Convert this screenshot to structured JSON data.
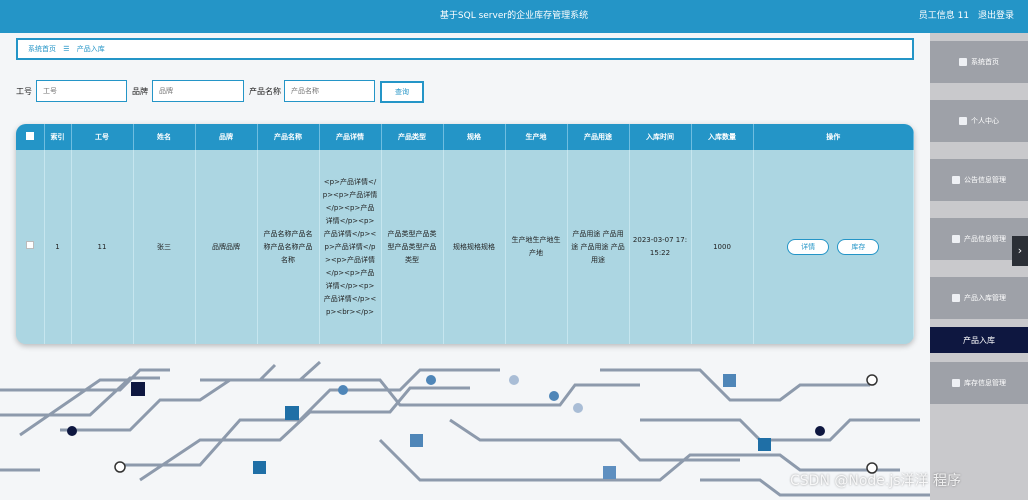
{
  "header": {
    "title": "基于SQL server的企业库存管理系统",
    "user_info": "员工信息 11",
    "logout": "退出登录"
  },
  "breadcrumb": {
    "home": "系统首页",
    "separator": "☰",
    "current": "产品入库"
  },
  "search": {
    "fields": [
      {
        "label": "工号",
        "placeholder": "工号"
      },
      {
        "label": "品牌",
        "placeholder": "品牌"
      },
      {
        "label": "产品名称",
        "placeholder": "产品名称"
      }
    ],
    "button": "查询"
  },
  "table": {
    "columns": [
      "索引",
      "工号",
      "姓名",
      "品牌",
      "产品名称",
      "产品详情",
      "产品类型",
      "规格",
      "生产地",
      "产品用途",
      "入库时间",
      "入库数量",
      "操作"
    ],
    "rows": [
      {
        "index": "1",
        "emp_no": "11",
        "name": "张三",
        "brand": "品牌品牌",
        "product_name": "产品名称产品名称产品名称产品名称",
        "detail": "<p>产品详情</p><p>产品详情</p><p>产品详情</p><p>产品详情</p><p>产品详情</p><p>产品详情</p><p>产品详情</p><p>产品详情</p><p><br></p>",
        "type": "产品类型产品类型产品类型产品类型",
        "spec": "规格规格规格",
        "origin": "生产地生产地生产地",
        "usage": "产品用途 产品用途 产品用途 产品用途",
        "time": "2023-03-07 17:15:22",
        "qty": "1000",
        "actions": [
          "详情",
          "库存"
        ]
      }
    ]
  },
  "sidebar": {
    "items": [
      {
        "label": "系统首页",
        "icon": "home-icon"
      },
      {
        "label": "个人中心",
        "icon": "user-icon"
      },
      {
        "label": "公告信息管理",
        "icon": "notice-icon"
      },
      {
        "label": "产品信息管理",
        "icon": "grid-icon"
      },
      {
        "label": "产品入库管理",
        "icon": "table-icon"
      },
      {
        "label": "产品入库",
        "icon": "",
        "active": true
      },
      {
        "label": "库存信息管理",
        "icon": "box-icon"
      }
    ],
    "handle": "›"
  },
  "watermark": "CSDN @Node.js洋洋 程序",
  "colors": {
    "primary": "#2495c7",
    "row_bg": "#acd6e2",
    "sidebar_active": "#0e1740",
    "sidebar_item": "#9ea1a8"
  }
}
